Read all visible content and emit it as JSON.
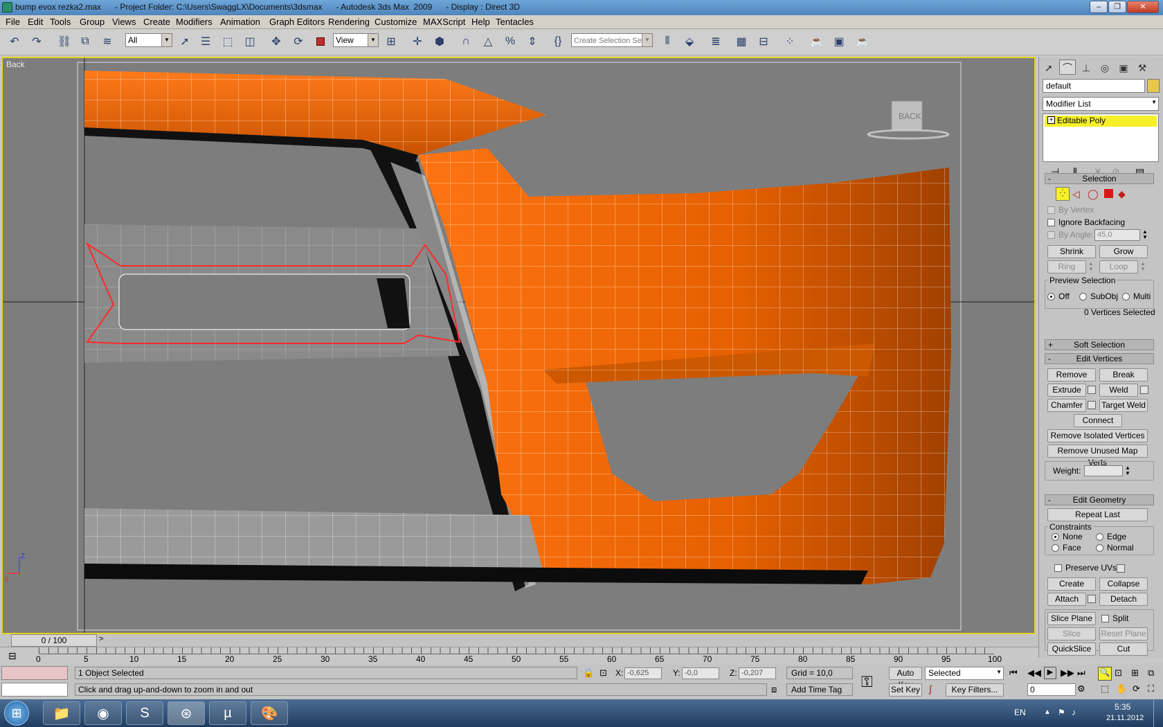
{
  "window": {
    "title": "bump evox rezka2.max      - Project Folder: C:\\Users\\SwaggLX\\Documents\\3dsmax      - Autodesk 3ds Max  2009      - Display : Direct 3D",
    "minimize_icon": "minimize-icon",
    "restore_icon": "restore-icon",
    "close_icon": "close-icon"
  },
  "menu": [
    "File",
    "Edit",
    "Tools",
    "Group",
    "Views",
    "Create",
    "Modifiers",
    "Animation",
    "Graph Editors",
    "Rendering",
    "Customize",
    "MAXScript",
    "Help",
    "Tentacles"
  ],
  "toolbar": {
    "selection_filter": "All",
    "reference_coord": "View",
    "named_selection_placeholder": "Create Selection Set",
    "icons": [
      "undo-icon",
      "redo-icon",
      "select-link-icon",
      "unlink-icon",
      "bind-spacewarp-icon",
      "select-object-icon",
      "select-by-name-icon",
      "rect-selection-icon",
      "window-crossing-icon",
      "move-icon",
      "rotate-icon",
      "scale-icon",
      "pivot-icon",
      "select-manipulate-icon",
      "snap-3d-icon",
      "angle-snap-icon",
      "percent-snap-icon",
      "spinner-snap-icon",
      "edit-named-selection-icon",
      "mirror-icon",
      "align-icon",
      "layer-manager-icon",
      "curve-editor-icon",
      "schematic-view-icon",
      "material-editor-icon",
      "render-setup-icon",
      "rendered-frame-icon",
      "render-teapot-icon"
    ]
  },
  "viewport": {
    "label": "Back",
    "viewcube_label": "BACK"
  },
  "command_panel": {
    "tabs": [
      "create-tab-icon",
      "modify-tab-icon",
      "hierarchy-tab-icon",
      "motion-tab-icon",
      "display-tab-icon",
      "utilities-tab-icon"
    ],
    "object_name": "default",
    "object_color": "#e8c84a",
    "modifier_list": "Modifier List",
    "stack_item": "Editable Poly",
    "selection": {
      "title": "Selection",
      "by_vertex": "By Vertex",
      "ignore_backfacing": "Ignore Backfacing",
      "by_angle": "By Angle:",
      "angle_value": "45,0",
      "shrink": "Shrink",
      "grow": "Grow",
      "ring": "Ring",
      "loop": "Loop",
      "preview_selection": "Preview Selection",
      "off": "Off",
      "subobj": "SubObj",
      "multi": "Multi",
      "count": "0 Vertices Selected"
    },
    "soft_selection": "Soft Selection",
    "edit_vertices": {
      "title": "Edit Vertices",
      "remove": "Remove",
      "break": "Break",
      "extrude": "Extrude",
      "weld": "Weld",
      "chamfer": "Chamfer",
      "target_weld": "Target Weld",
      "connect": "Connect",
      "remove_isolated": "Remove Isolated Vertices",
      "remove_unused": "Remove Unused Map Verts",
      "weight": "Weight:"
    },
    "edit_geometry": {
      "title": "Edit Geometry",
      "repeat_last": "Repeat Last",
      "constraints": "Constraints",
      "none": "None",
      "edge": "Edge",
      "face": "Face",
      "normal": "Normal",
      "preserve_uvs": "Preserve UVs",
      "create": "Create",
      "collapse": "Collapse",
      "attach": "Attach",
      "detach": "Detach",
      "slice_plane": "Slice Plane",
      "split": "Split",
      "slice": "Slice",
      "reset_plane": "Reset Plane",
      "quickslice": "QuickSlice",
      "cut": "Cut"
    }
  },
  "timeline": {
    "frame": "0 / 100",
    "ticks": [
      "0",
      "5",
      "10",
      "15",
      "20",
      "25",
      "30",
      "35",
      "40",
      "45",
      "50",
      "55",
      "60",
      "65",
      "70",
      "75",
      "80",
      "85",
      "90",
      "95",
      "100"
    ]
  },
  "status": {
    "selection_info": "1 Object Selected",
    "prompt": "Click and drag up-and-down to zoom in and out",
    "x_label": "X:",
    "x": "-0,625",
    "y_label": "Y:",
    "y": "-0,0",
    "z_label": "Z:",
    "z": "-0,207",
    "grid": "Grid = 10,0",
    "add_time_tag": "Add Time Tag",
    "auto_key": "Auto Key",
    "set_key": "Set Key",
    "key_mode": "Selected",
    "key_filters": "Key Filters...",
    "frame_input": "0"
  },
  "taskbar": {
    "apps": [
      "windows-start-icon",
      "explorer-icon",
      "chrome-icon",
      "skype-icon",
      "3dsmax-icon",
      "utorrent-icon",
      "paint-icon"
    ],
    "lang": "EN",
    "time": "5:35",
    "date": "21.11.2012"
  }
}
